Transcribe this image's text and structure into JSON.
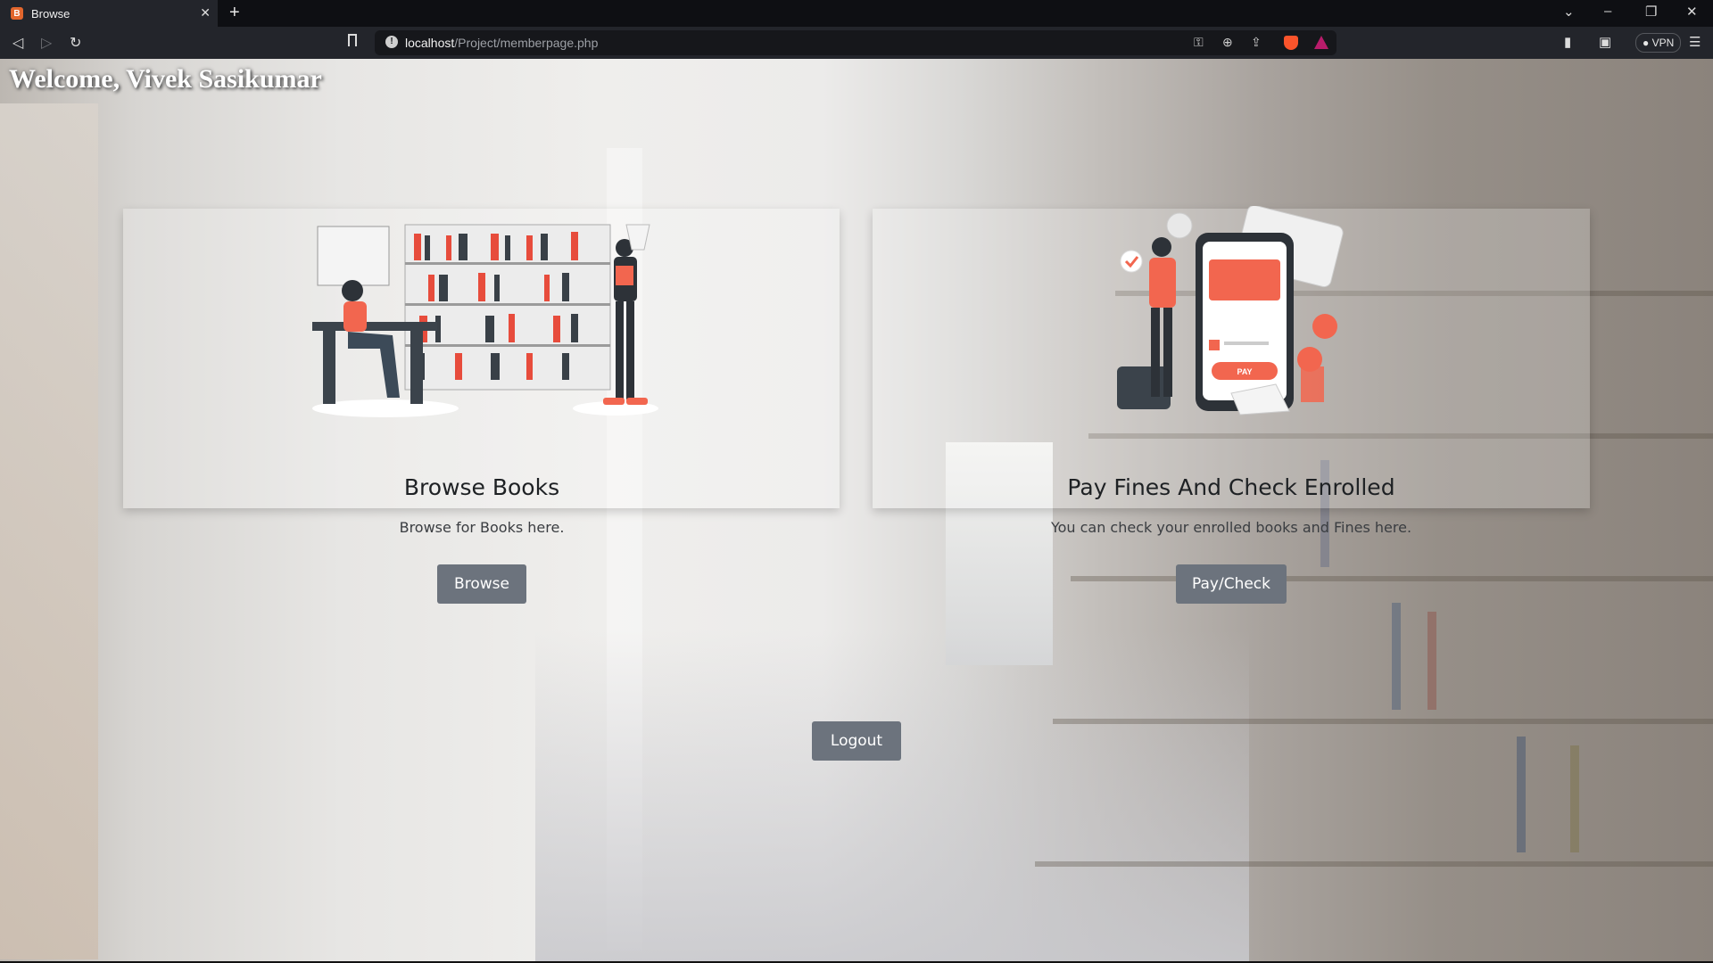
{
  "browser": {
    "tab_title": "Browse",
    "tab_favicon_letter": "B",
    "url_host": "localhost",
    "url_path": "/Project/memberpage.php",
    "vpn_label": "VPN",
    "brand_color": "#fb542b"
  },
  "page": {
    "welcome": "Welcome, Vivek Sasikumar",
    "cards": [
      {
        "title": "Browse Books",
        "text": "Browse for Books here.",
        "button": "Browse",
        "illustration": "bookshelf-illustration"
      },
      {
        "title": "Pay Fines And Check Enrolled",
        "text": "You can check your enrolled books and Fines here.",
        "button": "Pay/Check",
        "illustration": "mobile-payment-illustration"
      }
    ],
    "logout": "Logout",
    "illustration_pay_label": "PAY",
    "accent_color": "#f2664f",
    "button_color": "#6c737d"
  }
}
